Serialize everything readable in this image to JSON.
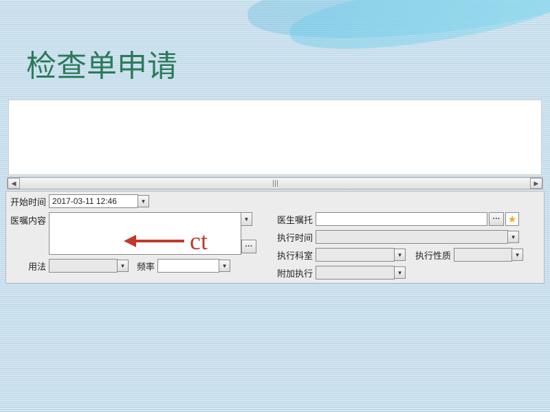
{
  "title": "检查单申请",
  "annotation": "ct",
  "form": {
    "start_time_label": "开始时间",
    "start_time_value": "2017-03-11 12:46",
    "order_content_label": "医嘱内容",
    "order_content_value": "",
    "usage_label": "用法",
    "usage_value": "",
    "freq_label": "频率",
    "freq_value": "",
    "doctor_note_label": "医生嘱托",
    "doctor_note_value": "",
    "exec_time_label": "执行时间",
    "exec_time_value": "",
    "exec_dept_label": "执行科室",
    "exec_dept_value": "",
    "exec_nature_label": "执行性质",
    "exec_nature_value": "",
    "addon_exec_label": "附加执行",
    "addon_exec_value": "",
    "ellipsis": "···",
    "star": "★"
  }
}
